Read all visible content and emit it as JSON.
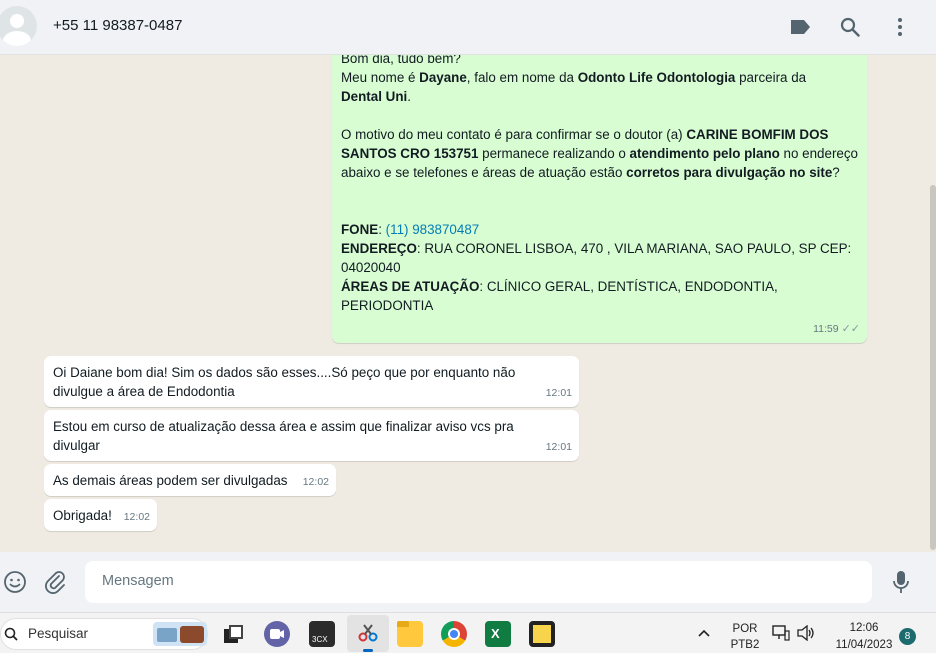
{
  "header": {
    "contact_name": "+55 11 98387-0487"
  },
  "messages": {
    "m1": {
      "l1": "Bom dia, tudo bem?",
      "l2a": "Meu nome é ",
      "l2b": "Dayane",
      "l2c": ", falo em nome da ",
      "l2d": "Odonto Life Odontologia",
      "l2e": " parceira da",
      "l3": "Dental Uni",
      "l3b": ".",
      "p2a": "O motivo do meu contato é para confirmar se o doutor (a) ",
      "p2b": "CARINE BOMFIM DOS SANTOS  CRO 153751",
      "p2c": " permanece realizando o ",
      "p2d": "atendimento pelo plano",
      "p2e": " no endereço abaixo e se telefones e áreas de atuação estão ",
      "p2f": "corretos para divulgação no site",
      "p2g": "?",
      "fone_label": "FONE",
      "fone_sep": ": ",
      "fone_value": "(11) 983870487",
      "end_label": "ENDEREÇO",
      "end_value": ": RUA CORONEL LISBOA, 470 , VILA MARIANA, SAO PAULO, SP CEP: 04020040",
      "areas_label": "ÁREAS DE ATUAÇÃO",
      "areas_value": ": CLÍNICO GERAL, DENTÍSTICA, ENDODONTIA, PERIODONTIA",
      "time": "11:59"
    },
    "m2": {
      "text": "Oi Daiane bom dia! Sim os dados são esses....Só peço que por enquanto não divulgue a área de Endodontia",
      "time": "12:01"
    },
    "m3": {
      "text": "Estou em curso de atualização dessa área e assim que finalizar aviso vcs pra divulgar",
      "time": "12:01"
    },
    "m4": {
      "text": "As demais áreas podem ser divulgadas",
      "time": "12:02"
    },
    "m5": {
      "text": "Obrigada!",
      "time": "12:02"
    }
  },
  "composer": {
    "placeholder": "Mensagem"
  },
  "taskbar": {
    "search_label": "Pesquisar",
    "lang_top": "POR",
    "lang_bottom": "PTB2",
    "clock_time": "12:06",
    "clock_date": "11/04/2023",
    "notif_count": "8",
    "app_3cx": "3CX"
  },
  "colors": {
    "outgoing_bubble": "#d9fdd3",
    "incoming_bubble": "#ffffff",
    "link": "#027eb5"
  }
}
